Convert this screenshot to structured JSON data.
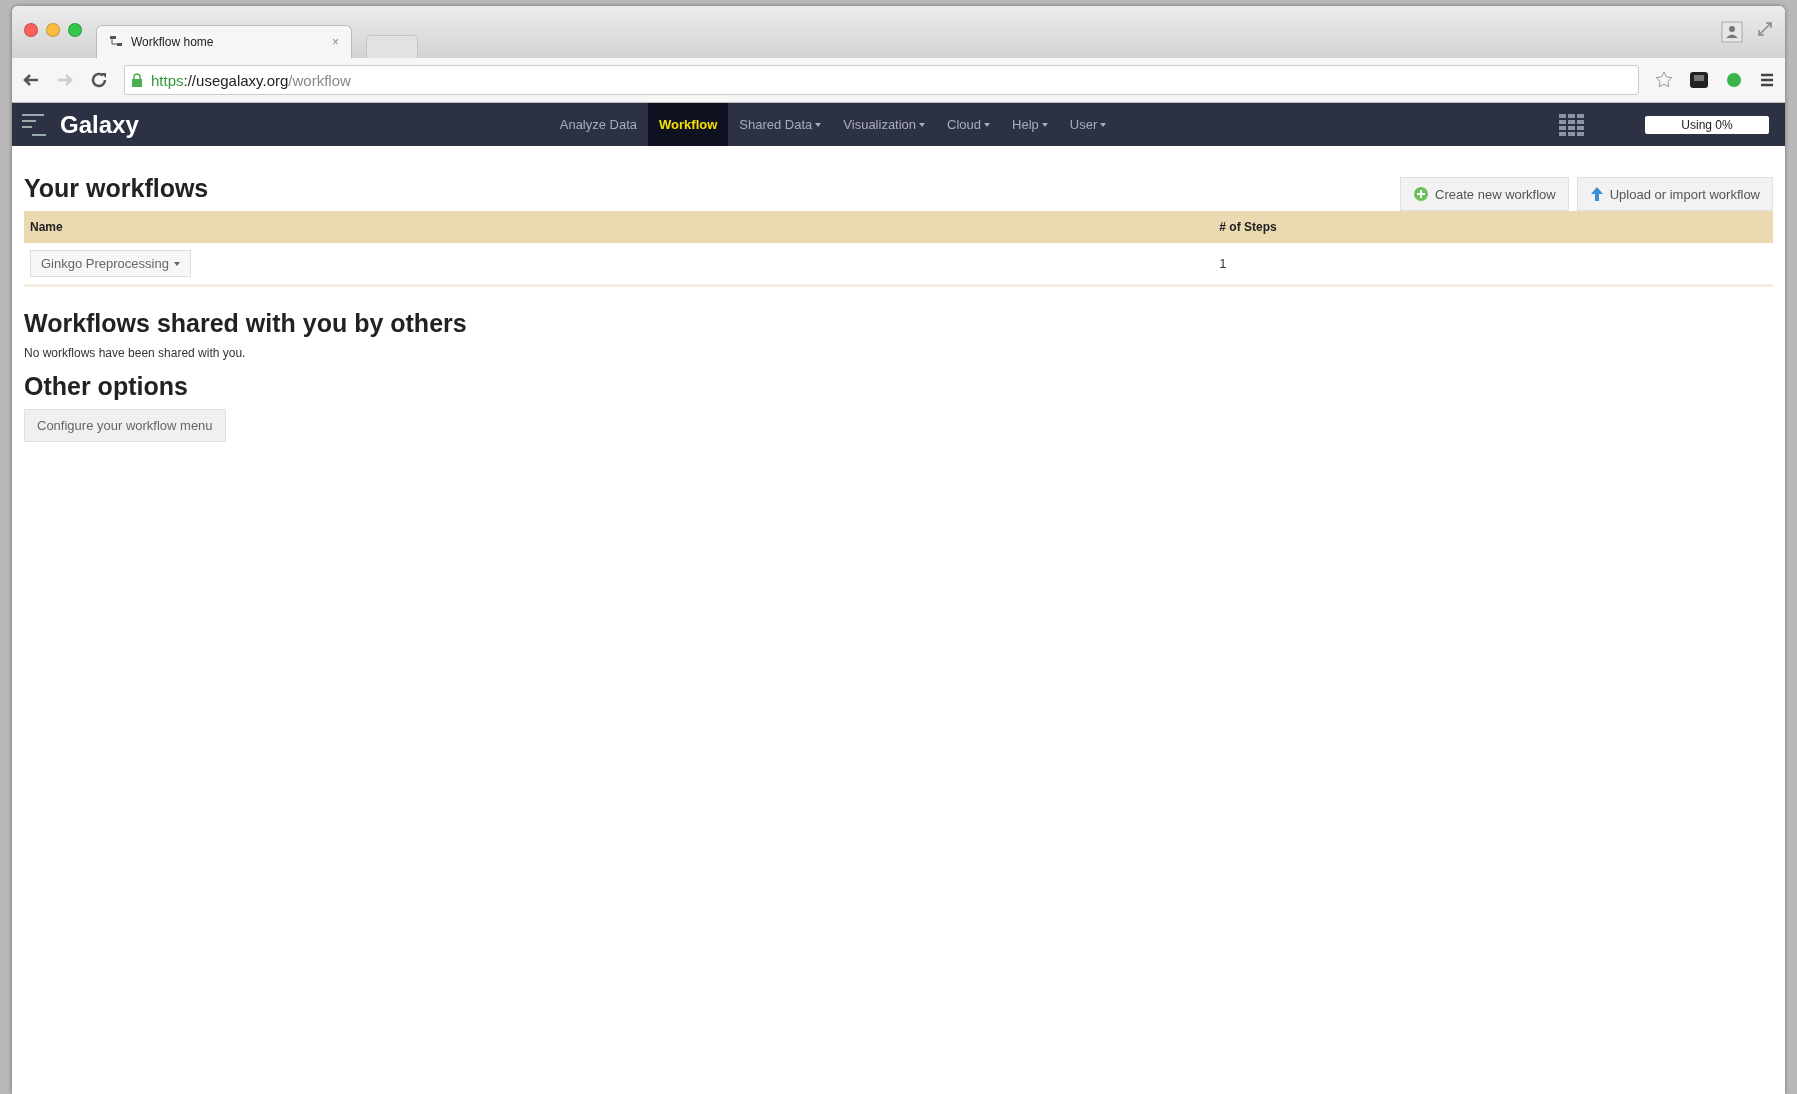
{
  "browser": {
    "tab_title": "Workflow home",
    "tab_close": "×",
    "url": {
      "scheme": "https",
      "host": "://usegalaxy.org",
      "path": "/workflow"
    }
  },
  "masthead": {
    "brand": "Galaxy",
    "nav": [
      {
        "label": "Analyze Data",
        "selected": false,
        "dropdown": false
      },
      {
        "label": "Workflow",
        "selected": true,
        "dropdown": false
      },
      {
        "label": "Shared Data",
        "selected": false,
        "dropdown": true
      },
      {
        "label": "Visualization",
        "selected": false,
        "dropdown": true
      },
      {
        "label": "Cloud",
        "selected": false,
        "dropdown": true
      },
      {
        "label": "Help",
        "selected": false,
        "dropdown": true
      },
      {
        "label": "User",
        "selected": false,
        "dropdown": true
      }
    ],
    "quota": "Using 0%"
  },
  "your_workflows": {
    "title": "Your workflows",
    "actions": [
      {
        "label": "Create new workflow",
        "kind": "create"
      },
      {
        "label": "Upload or import workflow",
        "kind": "upload"
      }
    ],
    "table": {
      "columns": [
        "Name",
        "# of Steps"
      ],
      "rows": [
        {
          "name": "Ginkgo Preprocessing",
          "steps": "1"
        }
      ]
    }
  },
  "shared": {
    "title": "Workflows shared with you by others",
    "message": "No workflows have been shared with you."
  },
  "other": {
    "title": "Other options",
    "button": "Configure your workflow menu"
  }
}
